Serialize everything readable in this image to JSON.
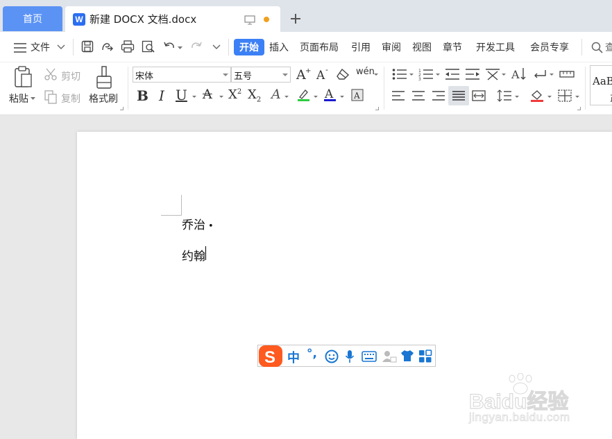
{
  "tabs": {
    "home_label": "首页",
    "doc_logo": "W",
    "doc_title": "新建 DOCX 文档.docx"
  },
  "menu": {
    "file_label": "文件",
    "tabs": [
      "开始",
      "插入",
      "页面布局",
      "引用",
      "审阅",
      "视图",
      "章节",
      "开发工具",
      "会员专享"
    ],
    "search_partial": "查"
  },
  "ribbon": {
    "paste": "粘贴",
    "cut": "剪切",
    "copy": "复制",
    "format_painter": "格式刷",
    "font_name": "宋体",
    "font_size": "五号",
    "pinyin": "wén",
    "style_preview": "AaB",
    "style_preview_2": "正"
  },
  "document": {
    "line1": "乔治",
    "line1_mark": "•",
    "line2": "约翰"
  },
  "ime": {
    "mode": "中",
    "punct": "°,",
    "brand_color": "#ff5a1f"
  },
  "watermark": {
    "top": "Baidu经验",
    "bottom": "jingyan.baidu.com"
  },
  "colors": {
    "accent": "#3c80f5",
    "home_tab": "#5b93f5",
    "highlight": "#2ecc40",
    "font_color": "#1a1ad0"
  }
}
